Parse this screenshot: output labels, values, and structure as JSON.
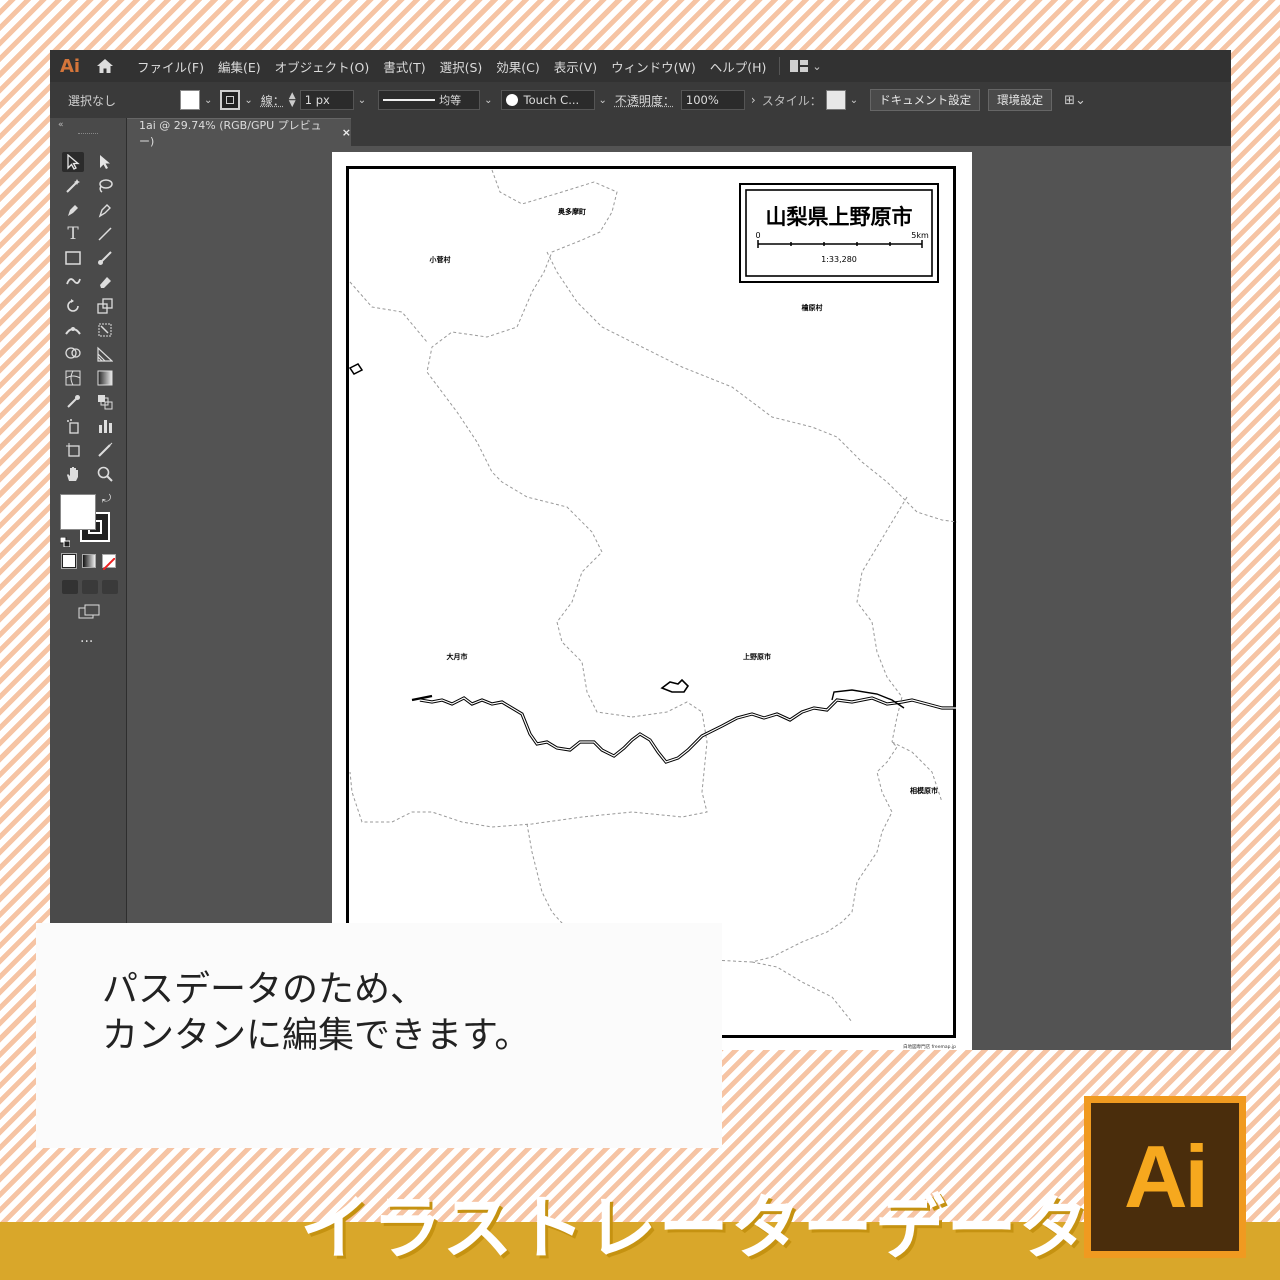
{
  "app": {
    "logo": "Ai",
    "menu": [
      "ファイル(F)",
      "編集(E)",
      "オブジェクト(O)",
      "書式(T)",
      "選択(S)",
      "効果(C)",
      "表示(V)",
      "ウィンドウ(W)",
      "ヘルプ(H)"
    ]
  },
  "control_bar": {
    "selection": "選択なし",
    "stroke_label": "線：",
    "stroke_weight": "1 px",
    "profile": "均等",
    "brush": "Touch C...",
    "opacity_label": "不透明度：",
    "opacity": "100%",
    "style_label": "スタイル：",
    "doc_settings": "ドキュメント設定",
    "preferences": "環境設定"
  },
  "document_tab": {
    "title": "1ai @ 29.74% (RGB/GPU プレビュー)",
    "close": "×"
  },
  "map": {
    "title": "山梨県上野原市",
    "scale_start": "0",
    "scale_end": "5km",
    "scale_ratio": "1:33,280",
    "labels": [
      "奥多摩町",
      "小菅村",
      "檜原村",
      "大月市",
      "上野原市",
      "相模原市"
    ],
    "credit": "白地図専門店 freemap.jp"
  },
  "callout": {
    "line1": "パスデータのため、",
    "line2": "カンタンに編集できます。"
  },
  "banner": {
    "text": "イラストレーターデータ",
    "icon_text": "Ai"
  },
  "colors": {
    "ai_orange": "#f09a20",
    "ai_brown": "#4a2d0c",
    "banner": "#d9a72a",
    "stripe": "#f6c4a4"
  }
}
